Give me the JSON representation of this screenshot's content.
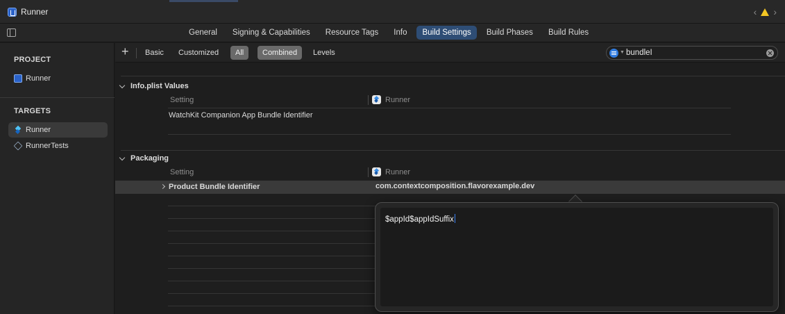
{
  "window": {
    "title": "Runner",
    "nav_back": "‹",
    "nav_forward": "›"
  },
  "tabs": [
    {
      "label": "General"
    },
    {
      "label": "Signing & Capabilities"
    },
    {
      "label": "Resource Tags"
    },
    {
      "label": "Info"
    },
    {
      "label": "Build Settings",
      "active": true
    },
    {
      "label": "Build Phases"
    },
    {
      "label": "Build Rules"
    }
  ],
  "sidebar": {
    "project_header": "PROJECT",
    "project_item": "Runner",
    "targets_header": "TARGETS",
    "targets": [
      {
        "label": "Runner",
        "selected": true
      },
      {
        "label": "RunnerTests"
      }
    ]
  },
  "toolbar": {
    "add_label": "+",
    "basic": "Basic",
    "customized": "Customized",
    "all": "All",
    "combined": "Combined",
    "levels": "Levels",
    "search_value": "bundleI"
  },
  "groups": {
    "info": {
      "title": "Info.plist Values",
      "col_setting": "Setting",
      "col_target": "Runner",
      "row": "WatchKit Companion App Bundle Identifier"
    },
    "packaging": {
      "title": "Packaging",
      "col_setting": "Setting",
      "col_target": "Runner",
      "row_label": "Product Bundle Identifier",
      "row_value": "com.contextcomposition.flavorexample.dev"
    }
  },
  "popover": {
    "value": "$appId$appIdSuffix"
  },
  "colors": {
    "accent": "#2e4d75",
    "warning": "#f3c623",
    "search_icon": "#2f7be0"
  }
}
